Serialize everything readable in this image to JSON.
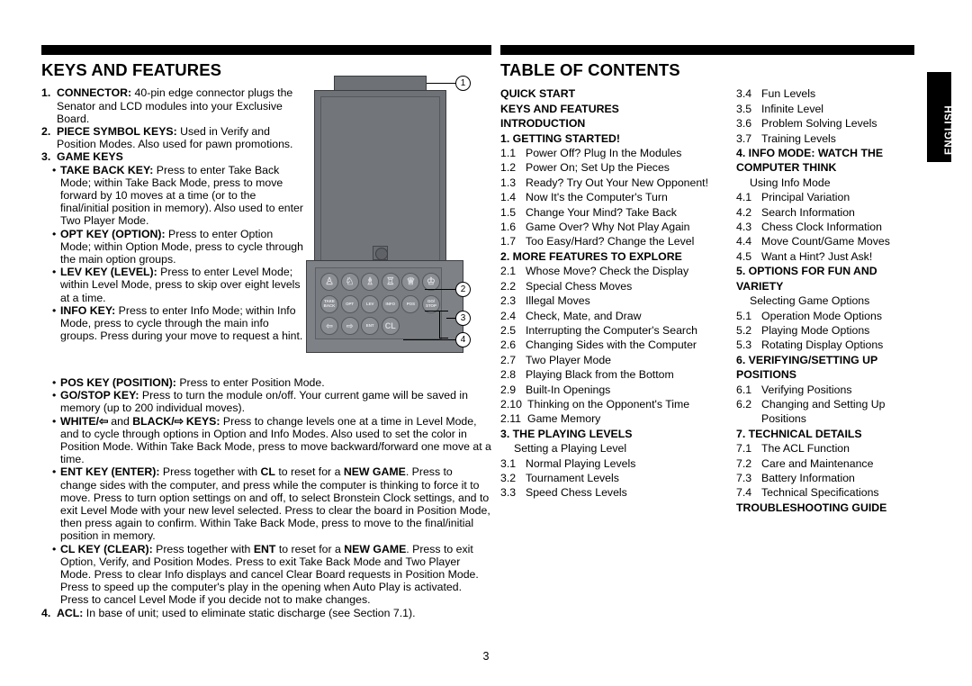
{
  "document": {
    "page_number": "3",
    "side_tab_label": "ENGLISH"
  },
  "left_section": {
    "title": "KEYS AND FEATURES",
    "items": [
      {
        "marker": "1.",
        "label": "CONNECTOR:",
        "text": " 40-pin edge connector plugs the Senator and LCD modules into your Exclusive Board."
      },
      {
        "marker": "2.",
        "label": "PIECE SYMBOL KEYS:",
        "text": " Used in Verify and Position Modes. Also used for pawn promotions."
      },
      {
        "marker": "3.",
        "label": "GAME KEYS",
        "text": ""
      }
    ],
    "bullets_narrow": [
      {
        "label": "TAKE BACK KEY:",
        "text": " Press to enter Take Back Mode; within Take Back Mode, press to move forward by 10 moves at a time (or to the final/initial position in memory). Also used to enter Two Player Mode."
      },
      {
        "label": "OPT KEY (OPTION):",
        "text": " Press to enter Option Mode; within Option Mode, press to cycle through the main option groups."
      },
      {
        "label": "LEV KEY (LEVEL):",
        "text": " Press to enter Level Mode; within Level Mode, press to skip over eight levels at a time."
      },
      {
        "label": "INFO KEY:",
        "text": " Press to enter Info Mode; within Info Mode, press to cycle through the main info groups. Press during your move to request a hint."
      }
    ],
    "bullet_pos": {
      "label": "POS KEY (POSITION):",
      "text": " Press to enter Position Mode."
    },
    "bullet_gostop": {
      "label": "GO/STOP KEY:",
      "text": " Press to turn the module on/off. Your current game will be saved in memory (up to 200 individual moves)."
    },
    "bullet_whiteblack": {
      "white": "WHITE/",
      "white_arrow": "⇦",
      "and": " and ",
      "black": "BLACK/",
      "black_arrow": "⇨",
      "keys": " KEYS:",
      "text": " Press to change levels one at a time in Level Mode, and to cycle through options in Option and Info Modes. Also used to set the color in Position Mode. Within Take Back Mode, press to move backward/forward one move at a time."
    },
    "bullet_ent": {
      "label": "ENT KEY (ENTER):",
      "part1": " Press together with ",
      "bold1": "CL",
      "part2": " to reset for a ",
      "bold2": "NEW GAME",
      "part3": ". Press to change sides with the computer, and press while the computer is thinking to force it to move. Press to turn option settings on and off, to select Bronstein Clock settings, and to exit Level Mode with your new level selected. Press to clear the board in Position Mode, then press again to confirm. Within Take Back Mode, press to move to the final/initial position in memory."
    },
    "bullet_cl": {
      "label": "CL KEY (CLEAR):",
      "part1": " Press together with ",
      "bold1": "ENT",
      "part2": " to reset for a ",
      "bold2": "NEW GAME",
      "part3": ". Press to exit Option, Verify, and Position Modes. Press to exit Take Back Mode and Two Player Mode. Press to clear Info displays and cancel Clear Board requests in Position Mode. Press to speed up the computer's play in the opening when Auto Play is activated. Press to cancel Level Mode if you decide not to make changes."
    },
    "item_acl": {
      "marker": "4.",
      "label": "ACL:",
      "text": " In base of unit; used to eliminate static discharge (see Section 7.1)."
    }
  },
  "device": {
    "callouts": [
      "1",
      "2",
      "3",
      "4"
    ],
    "piece_keys": [
      "♙",
      "♘",
      "♗",
      "♖",
      "♕",
      "♔"
    ],
    "game_keys": [
      "TAKE\nBACK",
      "OPT",
      "LEV",
      "INFO",
      "POS",
      "GO/\nSTOP"
    ],
    "control_keys": [
      "⇦",
      "⇨",
      "ENT",
      "CL"
    ]
  },
  "right_section": {
    "title": "TABLE OF CONTENTS",
    "column_a": [
      {
        "kind": "head",
        "text": "QUICK START"
      },
      {
        "kind": "head",
        "text": "KEYS AND FEATURES"
      },
      {
        "kind": "head",
        "text": "INTRODUCTION"
      },
      {
        "kind": "head",
        "text": "1. GETTING STARTED!"
      },
      {
        "kind": "entry",
        "num": "1.1",
        "text": "Power Off? Plug In the Modules"
      },
      {
        "kind": "entry",
        "num": "1.2",
        "text": "Power On; Set Up the Pieces"
      },
      {
        "kind": "entry",
        "num": "1.3",
        "text": "Ready? Try Out Your New Opponent!"
      },
      {
        "kind": "entry",
        "num": "1.4",
        "text": "Now It's the Computer's Turn"
      },
      {
        "kind": "entry",
        "num": "1.5",
        "text": "Change Your Mind? Take Back"
      },
      {
        "kind": "entry",
        "num": "1.6",
        "text": "Game Over? Why Not Play Again"
      },
      {
        "kind": "entry",
        "num": "1.7",
        "text": "Too Easy/Hard? Change the Level"
      },
      {
        "kind": "head",
        "text": "2. MORE FEATURES TO EXPLORE"
      },
      {
        "kind": "entry",
        "num": "2.1",
        "text": "Whose Move? Check the Display"
      },
      {
        "kind": "entry",
        "num": "2.2",
        "text": "Special Chess Moves"
      },
      {
        "kind": "entry",
        "num": "2.3",
        "text": "Illegal Moves"
      },
      {
        "kind": "entry",
        "num": "2.4",
        "text": "Check, Mate, and Draw"
      },
      {
        "kind": "entry",
        "num": "2.5",
        "text": "Interrupting the Computer's Search"
      },
      {
        "kind": "entry",
        "num": "2.6",
        "text": "Changing Sides with the Computer"
      },
      {
        "kind": "entry",
        "num": "2.7",
        "text": "Two Player Mode"
      },
      {
        "kind": "entry",
        "num": "2.8",
        "text": "Playing Black from the Bottom"
      },
      {
        "kind": "entry",
        "num": "2.9",
        "text": "Built-In Openings"
      },
      {
        "kind": "entry",
        "num": "2.10",
        "text": "Thinking on the Opponent's Time"
      },
      {
        "kind": "entry",
        "num": "2.11",
        "text": "Game Memory"
      },
      {
        "kind": "head",
        "text": "3. THE PLAYING LEVELS"
      },
      {
        "kind": "plain",
        "text": "Setting a Playing Level"
      },
      {
        "kind": "entry",
        "num": "3.1",
        "text": "Normal Playing Levels"
      },
      {
        "kind": "entry",
        "num": "3.2",
        "text": "Tournament Levels"
      },
      {
        "kind": "entry",
        "num": "3.3",
        "text": "Speed Chess Levels"
      }
    ],
    "column_b": [
      {
        "kind": "entry",
        "num": "3.4",
        "text": "Fun Levels"
      },
      {
        "kind": "entry",
        "num": "3.5",
        "text": "Infinite Level"
      },
      {
        "kind": "entry",
        "num": "3.6",
        "text": "Problem Solving Levels"
      },
      {
        "kind": "entry",
        "num": "3.7",
        "text": "Training Levels"
      },
      {
        "kind": "head",
        "text": "4. INFO MODE: WATCH THE COMPUTER THINK"
      },
      {
        "kind": "plain",
        "text": "Using Info Mode"
      },
      {
        "kind": "entry",
        "num": "4.1",
        "text": "Principal Variation"
      },
      {
        "kind": "entry",
        "num": "4.2",
        "text": "Search Information"
      },
      {
        "kind": "entry",
        "num": "4.3",
        "text": "Chess Clock Information"
      },
      {
        "kind": "entry",
        "num": "4.4",
        "text": "Move Count/Game Moves"
      },
      {
        "kind": "entry",
        "num": "4.5",
        "text": "Want a Hint? Just Ask!"
      },
      {
        "kind": "head",
        "text": "5. OPTIONS FOR FUN AND VARIETY"
      },
      {
        "kind": "plain",
        "text": "Selecting Game Options"
      },
      {
        "kind": "entry",
        "num": "5.1",
        "text": "Operation Mode Options"
      },
      {
        "kind": "entry",
        "num": "5.2",
        "text": "Playing Mode Options"
      },
      {
        "kind": "entry",
        "num": "5.3",
        "text": "Rotating Display Options"
      },
      {
        "kind": "head",
        "text": "6. VERIFYING/SETTING UP POSITIONS"
      },
      {
        "kind": "entry",
        "num": "6.1",
        "text": "Verifying Positions"
      },
      {
        "kind": "entry",
        "num": "6.2",
        "text": "Changing and Setting Up Positions"
      },
      {
        "kind": "head",
        "text": "7. TECHNICAL DETAILS"
      },
      {
        "kind": "entry",
        "num": "7.1",
        "text": "The ACL Function"
      },
      {
        "kind": "entry",
        "num": "7.2",
        "text": "Care and Maintenance"
      },
      {
        "kind": "entry",
        "num": "7.3",
        "text": "Battery Information"
      },
      {
        "kind": "entry",
        "num": "7.4",
        "text": "Technical Specifications"
      },
      {
        "kind": "head",
        "text": "TROUBLESHOOTING GUIDE"
      }
    ]
  }
}
